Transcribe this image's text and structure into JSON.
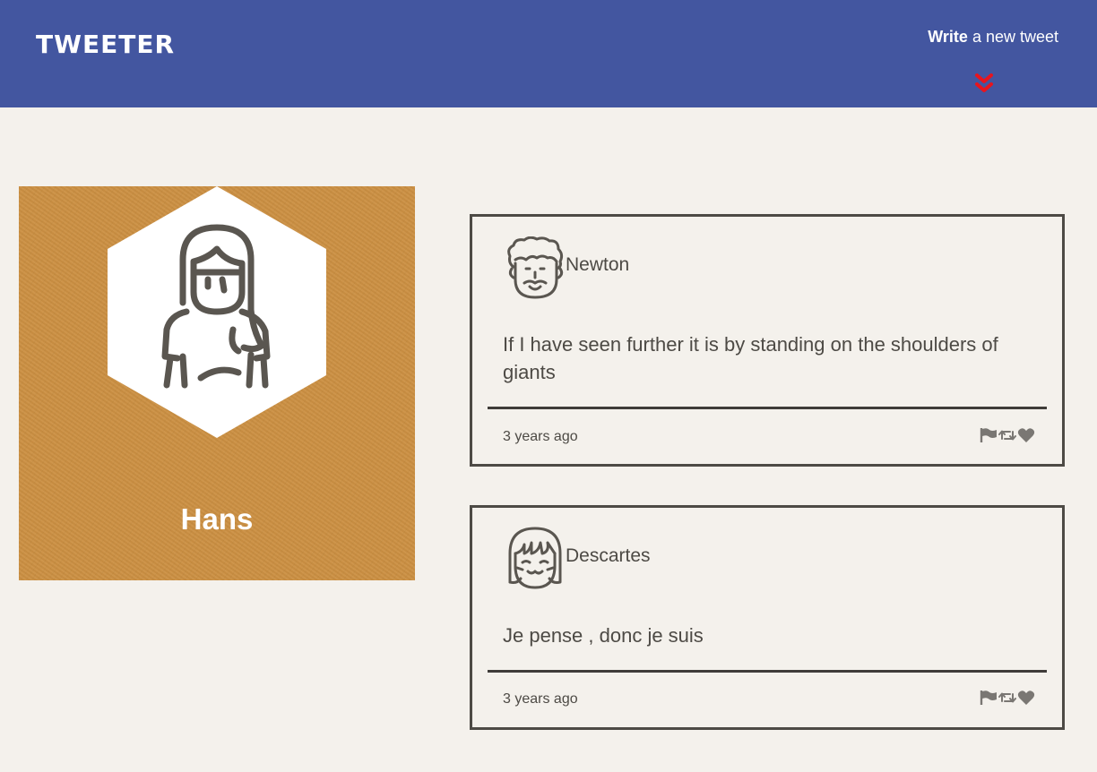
{
  "header": {
    "brand": "TWEETER",
    "compose_bold": "Write",
    "compose_rest": " a new tweet",
    "chevron_icon": "double-chevron-down-icon",
    "chevron_color": "#e8141e",
    "background": "#4356a0"
  },
  "profile": {
    "name": "Hans",
    "avatar_icon": "woman-long-hair-icon",
    "background": "#cc9043"
  },
  "tweets": [
    {
      "author": "Newton",
      "avatar_icon": "curly-hair-man-icon",
      "content": "If I have seen further it is by standing on the shoulders of giants",
      "time": "3 years ago",
      "actions": [
        "flag-icon",
        "retweet-icon",
        "heart-icon"
      ]
    },
    {
      "author": "Descartes",
      "avatar_icon": "bob-hair-face-icon",
      "content": "Je pense , donc je suis",
      "time": "3 years ago",
      "actions": [
        "flag-icon",
        "retweet-icon",
        "heart-icon"
      ]
    }
  ],
  "colors": {
    "page_background": "#f4f1ec",
    "text": "#4d4a45",
    "icon_gray": "#7a7773"
  }
}
